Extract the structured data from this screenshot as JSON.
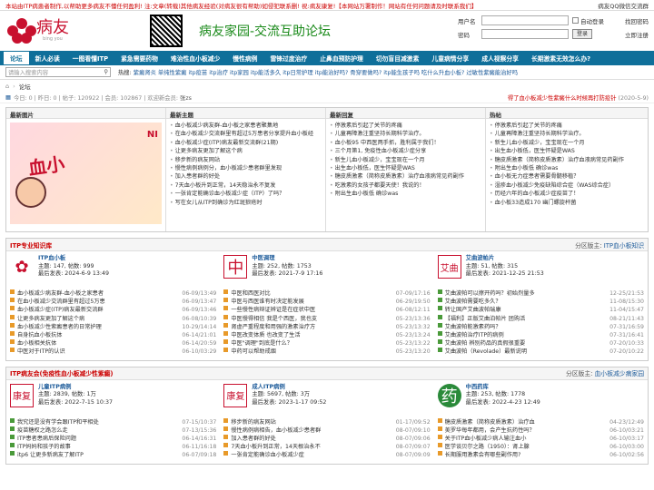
{
  "topbar": {
    "notice": "本站由ITP病患者制作,以帮助更多病友不懂任何盈利! 注:文章(转载)其他病友经验(对病友很有帮助)如侵犯联系删! 祝:病友康复!【本网站万署制作！网站有任何问题请及时联系我们】",
    "right": "病友QQ微信交流群"
  },
  "logo": {
    "name": "病友",
    "tagline": "bing you"
  },
  "slogan": "病友家园-交流互助论坛",
  "login": {
    "user_label": "用户名",
    "pass_label": "密码",
    "auto_login": "自动登录",
    "login_btn": "登录",
    "find_pwd": "找回密码",
    "register": "立即注册"
  },
  "nav": [
    "论坛",
    "新人必读",
    "一图看懂ITP",
    "紧急需要药物",
    "难治性血小板减少",
    "慢性病例",
    "雷锋过度治疗",
    "止鼻血预防护理",
    "切勿盲目减激素",
    "儿童病情分享",
    "成人视察分享",
    "长期激素无效怎么办?"
  ],
  "search": {
    "placeholder": "请输入搜索内容"
  },
  "hot": {
    "label": "热搜:",
    "items": "紫癜肾炎 单纯性紫癜 itp疫苗 itp治疗 itp家园 itp能活多久 itp日常护理 itp能治好吗? 骨穿要做吗? itp能生孩子吗 吃什么升血小板? 过敏性紫癜能治好吗"
  },
  "crumb": "论坛",
  "stats": {
    "text": "今日: 0 | 昨日: 0 | 帖子: 120922 | 会员: 102867 | 欢迎新会员:",
    "newmember": "张zs",
    "announce": "得了血小板减少性紫癜什么时候再打防疫针",
    "announce_date": "(2020-5-9)"
  },
  "blocks": {
    "pic_title": "最新图片",
    "pic_big": "血小",
    "pic_ni": "NI",
    "topics_title": "最新主题",
    "topics": [
      "血小板减少病友群-血小板之家患者聚集地",
      "在血小板减少交流群里有超过5万患者分享提升血小板经",
      "血小板减少症(ITP)病友最新交流群(21期)",
      "让更多病友更加了解这个病",
      "移步新的病友网站",
      "慢性病例病例分，血小板减少患者群里发现",
      "加入患者群的好处",
      "7天血小板升到正常，14天稳治永不复发",
      "一张肯定能确诊血小板减少症（ITP）了吗？",
      "写在女儿从ITP到确诊为红斑狼疮时"
    ],
    "replies_title": "最新回复",
    "replies": [
      "停激素后引起了关节的疼痛",
      "儿童再障激注重坚持长期科学治疗。",
      "血小板95 中西医两手抓，胜利属于我们！",
      "三个月第1, 免疫性血小板减少症分享",
      "新生儿血小板减少，宝宝现在一个月",
      "出生血小板低，医生怀疑是WAS",
      "糖皮质激素（简称皮质激素）治疗血液病常见药副作",
      "吃激素的女孩子都要天使！我说的！",
      "附出生血小板低 确诊was"
    ],
    "hot_title": "热帖",
    "hot": [
      "停激素后引起了关节的疼痛",
      "儿童再障激注重坚持长期科学治疗。",
      "新生儿血小板减少，宝宝现在一个月",
      "出生血小板低，医生怀疑是WAS",
      "糖皮质激素（简称皮质激素）治疗血液病常见药副作",
      "附出生血小板低 确诊was",
      "血小板无力症患者需要骨髓移植？",
      "湿疹血小板减少免疫缺陷综合症（WAS综合症）",
      "历经六年的血小板减少症疫苗了！",
      "血小板33造成170 幽门螺旋杆菌"
    ]
  },
  "sec1": {
    "title": "ITP专业知识库",
    "mod_label": "分区版主:",
    "mod": "ITP血小板知识",
    "forums": [
      {
        "icon": "flower",
        "name": "ITP血小板",
        "stat": "主题: 147, 帖数: 999",
        "last": "最后发表: 2024-6-9 13:49",
        "rows": [
          [
            "血小板减少病友群-血小板之家患者",
            "06-09/13:49"
          ],
          [
            "在血小板减少交流群里有超过5万患",
            "06-09/13:47"
          ],
          [
            "血小板减少症(ITP)病友最新交流群",
            "06-09/13:46"
          ],
          [
            "让更多病友更加了解这个病",
            "06-08/10:39"
          ],
          [
            "血小板减少性紫癜患者的日常护理",
            "10-29/14:14"
          ],
          [
            "自身抗血小板抗体",
            "06-14/21:01"
          ],
          [
            "血小板相关抗体",
            "06-14/20:59"
          ],
          [
            "中医对于ITP的认识",
            "06-10/03:29"
          ]
        ]
      },
      {
        "icon": "中",
        "name": "中医调理",
        "stat": "主题: 252, 帖数: 1753",
        "last": "最后发表: 2021-7-9 17:16",
        "rows": [
          [
            "中医和西医对比",
            "07-09/17:16"
          ],
          [
            "中医与西医谁有时决定能发展",
            "06-29/19:50"
          ],
          [
            "一些慢性病辩证辨证是在症状中医",
            "06-08/12:11"
          ],
          [
            "中医慢得相信 我是个西医，我也支",
            "05-23/13:36"
          ],
          [
            "肾虚严重程度和用强的激素治疗方",
            "05-23/13:32"
          ],
          [
            "中医改变体质 也改变了生活",
            "05-23/13:24"
          ],
          [
            "中医\"调理\"到底是什么？",
            "05-23/13:22"
          ],
          [
            "中药可以帮助戒烟",
            "05-23/13:20"
          ]
        ]
      },
      {
        "icon": "艾曲",
        "name": "艾曲波帕片",
        "stat": "主题: 51, 帖数: 315",
        "last": "最后发表: 2021-12-25 21:53",
        "rows": [
          [
            "艾曲波帕可以擦开药吗？初始剂量多",
            "12-25/21:53"
          ],
          [
            "艾曲波帕需要吃多久？",
            "11-08/15:30"
          ],
          [
            "转让国产艾曲波帕瑞康",
            "11-04/15:47"
          ],
          [
            "【福利】正版艾曲泊帕片 团购活",
            "08-21/11:43"
          ],
          [
            "艾曲波帕能激素药吗？",
            "07-31/16:59"
          ],
          [
            "艾曲波帕治疗ITP的病例",
            "07-31/16:41"
          ],
          [
            "艾曲波帕 辨别药品的真假很重要",
            "07-20/10:33"
          ],
          [
            "艾曲波帕（Revolade）最新说明",
            "07-20/10:22"
          ]
        ]
      }
    ]
  },
  "sec2": {
    "title": "ITP病友会(免疫性血小板减少性紫癜)",
    "mod_label": "分区版主:",
    "mod": "血小板减少病家园",
    "forums": [
      {
        "icon": "康复",
        "name": "儿童ITP病例",
        "stat": "主题: 2839, 帖数: 1万",
        "last": "最后发表: 2022-7-15 10:37",
        "rows": [
          [
            "我究还是没有学会跟ITP和平相处",
            "07-15/10:37"
          ],
          [
            "疫苗糖权之路怎么走",
            "07-13/15:36"
          ],
          [
            "ITP患者患病后保险问题",
            "06-14/16:31"
          ],
          [
            "ITP妈妈和孩子的故事",
            "06-11/16:18"
          ],
          [
            "itp6 让更多新病友了解ITP",
            "06-07/09:18"
          ]
        ]
      },
      {
        "icon": "康复",
        "name": "成人ITP病例",
        "stat": "主题: 5697, 帖数: 3万",
        "last": "最后发表: 2023-1-17 09:52",
        "rows": [
          [
            "移步新的病友网站",
            "01-17/09:52"
          ],
          [
            "慢性病例病相告，血小板减少患者群",
            "08-07/09:10"
          ],
          [
            "加入患者群的好处",
            "08-07/09:06"
          ],
          [
            "7天血小板升到正常，14天根治永不",
            "08-07/09:07"
          ],
          [
            "一张肯定能确诊血小板减少症",
            "08-07/09:09"
          ]
        ]
      },
      {
        "icon": "药",
        "name": "中西药库",
        "stat": "主题: 253, 帖数: 1778",
        "last": "最后发表: 2022-4-23 12:49",
        "rows": [
          [
            "糖皮质激素（简称皮质激素）治疗血",
            "04-23/12:49"
          ],
          [
            "美罗华每年都用，会产生抗药性吗？",
            "06-10/03:21"
          ],
          [
            "关于ITP血小板减少病人输注血小",
            "06-10/03:17"
          ],
          [
            "医学谈贝尔之路（1950）：肾上腺",
            "06-10/03:00"
          ],
          [
            "长期服用激素会有哪些副作用?",
            "06-10/02:56"
          ]
        ]
      }
    ]
  }
}
